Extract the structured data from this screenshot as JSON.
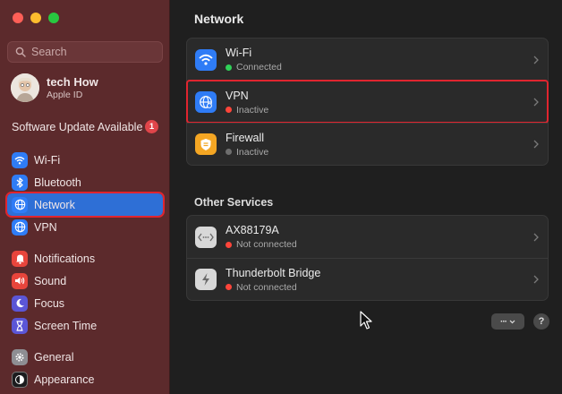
{
  "window": {
    "traffic_lights": {
      "close": "#ff5f57",
      "minimize": "#febc2e",
      "zoom": "#28c840"
    }
  },
  "sidebar": {
    "search_placeholder": "Search",
    "profile": {
      "name": "tech How",
      "subtitle": "Apple ID"
    },
    "update": {
      "label": "Software Update Available",
      "badge": "1"
    },
    "items": [
      {
        "label": "Wi-Fi",
        "icon": "wifi-icon",
        "color": "#2f7cf6"
      },
      {
        "label": "Bluetooth",
        "icon": "bluetooth-icon",
        "color": "#2f7cf6"
      },
      {
        "label": "Network",
        "icon": "globe-icon",
        "color": "#2f7cf6",
        "selected": true
      },
      {
        "label": "VPN",
        "icon": "globe-icon",
        "color": "#2f7cf6"
      },
      {
        "label": "Notifications",
        "icon": "bell-icon",
        "color": "#e8453c"
      },
      {
        "label": "Sound",
        "icon": "speaker-icon",
        "color": "#e8453c"
      },
      {
        "label": "Focus",
        "icon": "moon-icon",
        "color": "#5b56d6"
      },
      {
        "label": "Screen Time",
        "icon": "hourglass-icon",
        "color": "#5b56d6"
      },
      {
        "label": "General",
        "icon": "gear-icon",
        "color": "#8e8e93"
      },
      {
        "label": "Appearance",
        "icon": "appearance-icon",
        "color": "#1c1c1e"
      }
    ]
  },
  "main": {
    "title": "Network",
    "services": [
      {
        "title": "Wi-Fi",
        "status": "Connected",
        "status_color": "#30d158",
        "icon": "wifi-icon",
        "icon_color": "#2f7cf6"
      },
      {
        "title": "VPN",
        "status": "Inactive",
        "status_color": "#ff453a",
        "icon": "globe-icon",
        "icon_color": "#2f7cf6",
        "highlighted": true
      },
      {
        "title": "Firewall",
        "status": "Inactive",
        "status_color": "#6e6e6e",
        "icon": "shield-icon",
        "icon_color": "#f4a623"
      }
    ],
    "other_services_title": "Other Services",
    "other_services": [
      {
        "title": "AX88179A",
        "status": "Not connected",
        "status_color": "#ff453a",
        "icon": "ethernet-icon"
      },
      {
        "title": "Thunderbolt Bridge",
        "status": "Not connected",
        "status_color": "#ff453a",
        "icon": "thunderbolt-icon"
      }
    ],
    "more_button_label": "···",
    "help_button_label": "?"
  }
}
